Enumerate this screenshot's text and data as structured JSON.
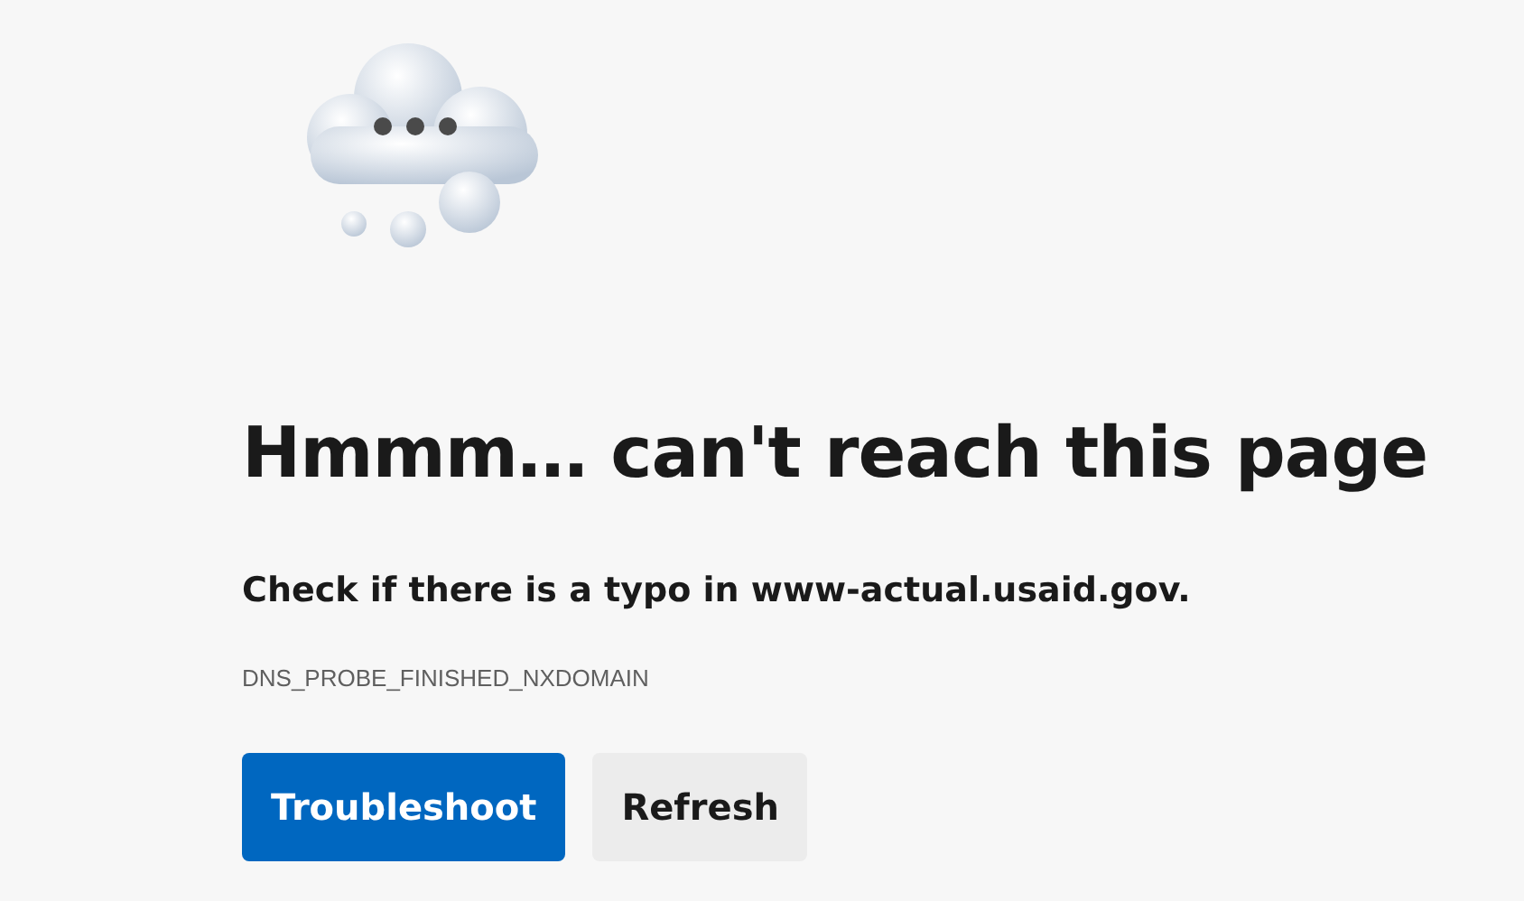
{
  "heading": "Hmmm… can't reach this page",
  "message": "Check if there is a typo in www-actual.usaid.gov.",
  "error_code": "DNS_PROBE_FINISHED_NXDOMAIN",
  "buttons": [
    {
      "label": "Troubleshoot",
      "kind": "primary"
    },
    {
      "label": "Refresh",
      "kind": "secondary"
    }
  ]
}
